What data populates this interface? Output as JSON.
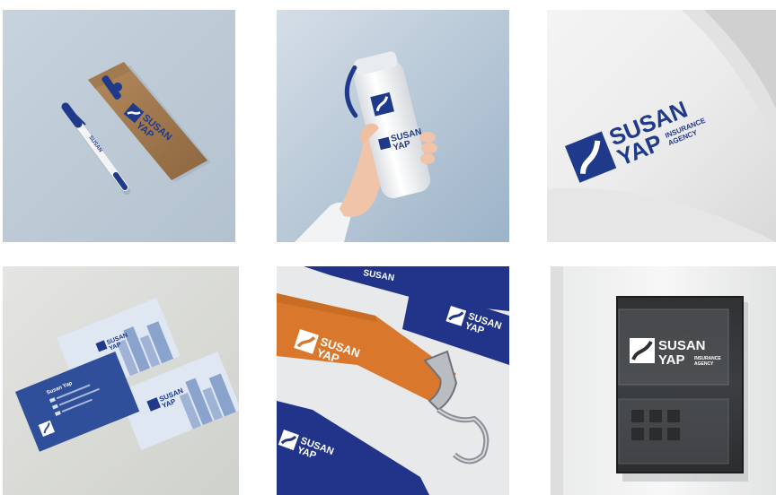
{
  "brand": {
    "name_line1": "SUSAN",
    "name_line2": "YAP",
    "tagline_line1": "INSURANCE",
    "tagline_line2": "AGENCY",
    "primary_color": "#1f3a8a",
    "accent_color": "#d9782d"
  },
  "tiles": [
    {
      "icon": "pen-and-pencil-case-mockup"
    },
    {
      "icon": "water-bottle-mockup"
    },
    {
      "icon": "paper-letterhead-mockup"
    },
    {
      "icon": "business-card-mockup"
    },
    {
      "icon": "lanyard-mockup"
    },
    {
      "icon": "glass-sign-mockup"
    }
  ],
  "business_card": {
    "person_name": "Susan Yap"
  }
}
